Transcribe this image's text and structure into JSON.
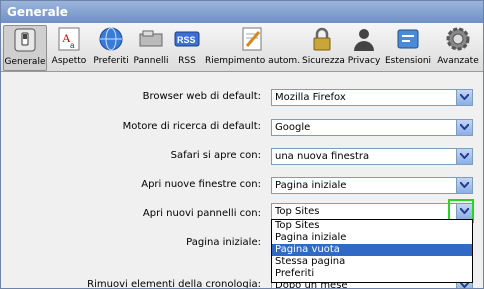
{
  "window": {
    "title": "Generale"
  },
  "toolbar": {
    "items": [
      {
        "label": "Generale",
        "icon": "switch-icon",
        "selected": true
      },
      {
        "label": "Aspetto",
        "icon": "font-icon"
      },
      {
        "label": "Preferiti",
        "icon": "globe-icon"
      },
      {
        "label": "Pannelli",
        "icon": "tab-icon"
      },
      {
        "label": "RSS",
        "icon": "rss-icon"
      },
      {
        "label": "Riempimento autom.",
        "icon": "pencil-icon"
      },
      {
        "label": "Sicurezza",
        "icon": "lock-icon"
      },
      {
        "label": "Privacy",
        "icon": "person-icon"
      },
      {
        "label": "Estensioni",
        "icon": "puzzle-icon"
      },
      {
        "label": "Avanzate",
        "icon": "gear-icon"
      }
    ]
  },
  "settings": {
    "browser_label": "Browser web di default:",
    "browser_value": "Mozilla Firefox",
    "search_label": "Motore di ricerca di default:",
    "search_value": "Google",
    "opens_with_label": "Safari si apre con:",
    "opens_with_value": "una nuova finestra",
    "new_windows_label": "Apri nuove finestre con:",
    "new_windows_value": "Pagina iniziale",
    "new_tabs_label": "Apri nuovi pannelli con:",
    "new_tabs_value": "Top Sites",
    "homepage_label": "Pagina iniziale:",
    "history_label": "Rimuovi elementi della cronologia:",
    "history_value": "Dopo un mese"
  },
  "dropdown": {
    "options": [
      "Top Sites",
      "Pagina iniziale",
      "Pagina vuota",
      "Stessa pagina",
      "Preferiti"
    ],
    "highlighted": "Pagina vuota"
  },
  "colors": {
    "highlight": "#316ac5",
    "focus_ring": "#2bd22b",
    "titlebar": "#7f9fd0"
  }
}
